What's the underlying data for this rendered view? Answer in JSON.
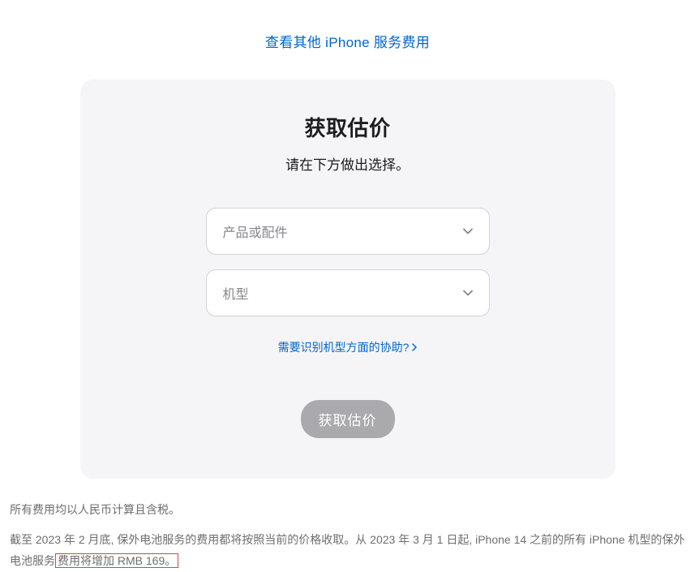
{
  "topLink": "查看其他 iPhone 服务费用",
  "card": {
    "title": "获取估价",
    "subtitle": "请在下方做出选择。",
    "select1": {
      "placeholder": "产品或配件"
    },
    "select2": {
      "placeholder": "机型"
    },
    "helpLink": "需要识别机型方面的协助?",
    "button": "获取估价"
  },
  "footer": {
    "line1": "所有费用均以人民币计算且含税。",
    "line2a": "截至 2023 年 2 月底, 保外电池服务的费用都将按照当前的价格收取。从 2023 年 3 月 1 日起, iPhone 14 之前的所有 iPhone 机型的保外电池服务",
    "line2b": "费用将增加 RMB 169。"
  }
}
